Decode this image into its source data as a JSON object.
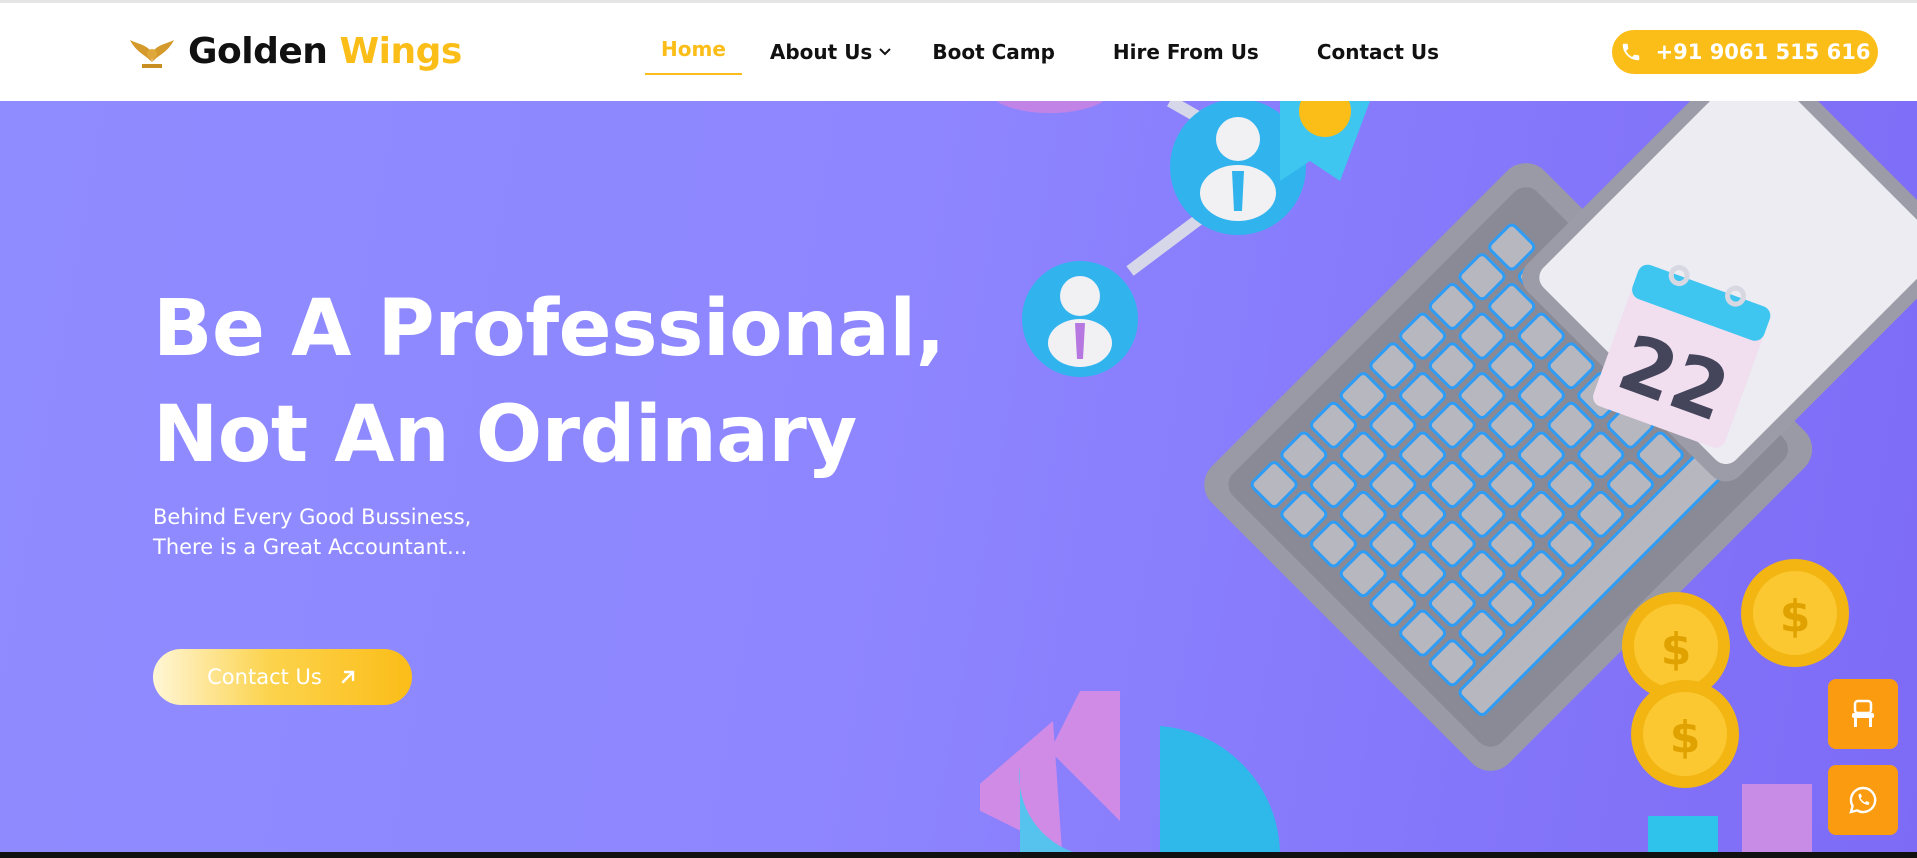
{
  "brand": {
    "name_part1": "Golden ",
    "name_part2": "Wings",
    "logo_icon": "wings-emblem-icon"
  },
  "nav": {
    "items": [
      {
        "label": "Home",
        "active": true
      },
      {
        "label": "About Us",
        "has_dropdown": true
      },
      {
        "label": "Boot Camp"
      },
      {
        "label": "Hire From Us"
      },
      {
        "label": "Contact Us"
      }
    ]
  },
  "phone": {
    "label": "+91 9061 515 616",
    "icon": "phone-icon"
  },
  "hero": {
    "headline_line1": "Be A Professional,",
    "headline_line2": "Not An Ordinary",
    "sub_line1": "Behind Every Good Bussiness,",
    "sub_line2": "There is a Great Accountant...",
    "cta_label": "Contact Us",
    "cta_icon": "arrow-up-right-icon"
  },
  "floating": [
    {
      "icon": "chair-icon"
    },
    {
      "icon": "whatsapp-icon"
    }
  ],
  "colors": {
    "accent": "#fbbd18",
    "hero_bg": "#8f8cff",
    "float": "#fb9b10"
  },
  "illustration": {
    "calendar_day": "22"
  }
}
